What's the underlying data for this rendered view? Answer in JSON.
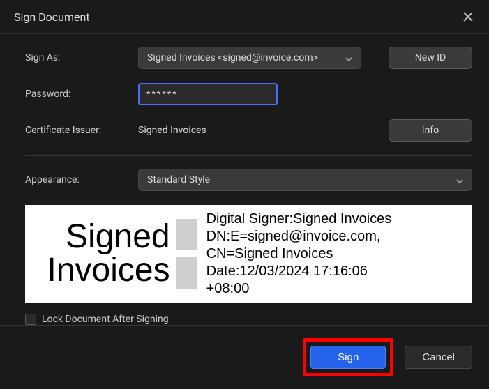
{
  "window": {
    "title": "Sign Document"
  },
  "labels": {
    "sign_as": "Sign As:",
    "password": "Password:",
    "certificate_issuer": "Certificate Issuer:",
    "appearance": "Appearance:"
  },
  "sign_as": {
    "selected": "Signed Invoices <signed@invoice.com>"
  },
  "password": {
    "value": "******"
  },
  "new_id_label": "New ID",
  "certificate_issuer": {
    "value": "Signed Invoices"
  },
  "info_label": "Info",
  "appearance": {
    "selected": "Standard Style"
  },
  "signature_preview": {
    "name_line1": "Signed",
    "name_line2": "Invoices",
    "detail_line1": "Digital Signer:Signed Invoices",
    "detail_line2": "DN:E=signed@invoice.com,",
    "detail_line3": "CN=Signed Invoices",
    "detail_line4": "Date:12/03/2024 17:16:06",
    "detail_line5": "+08:00"
  },
  "lock_document_label": "Lock Document After Signing",
  "buttons": {
    "sign": "Sign",
    "cancel": "Cancel"
  }
}
